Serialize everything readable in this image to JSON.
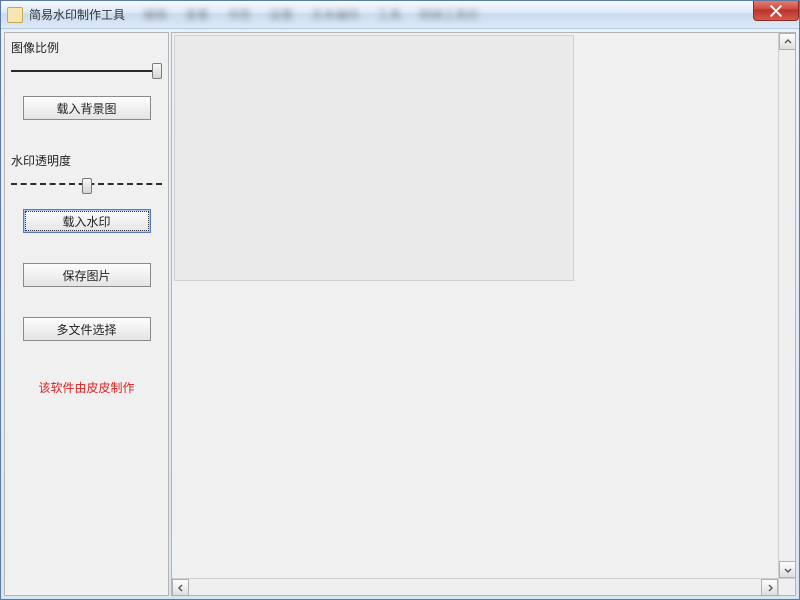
{
  "window": {
    "title": "简易水印制作工具"
  },
  "sidebar": {
    "scale_label": "图像比例",
    "opacity_label": "水印透明度",
    "load_bg_button_label": "载入背景图",
    "load_watermark_button_label": "载入水印",
    "save_image_button_label": "保存图片",
    "multi_file_button_label": "多文件选择",
    "credit_text": "该软件由皮皮制作"
  },
  "sliders": {
    "scale_value_percent": 100,
    "opacity_value_percent": 50
  }
}
